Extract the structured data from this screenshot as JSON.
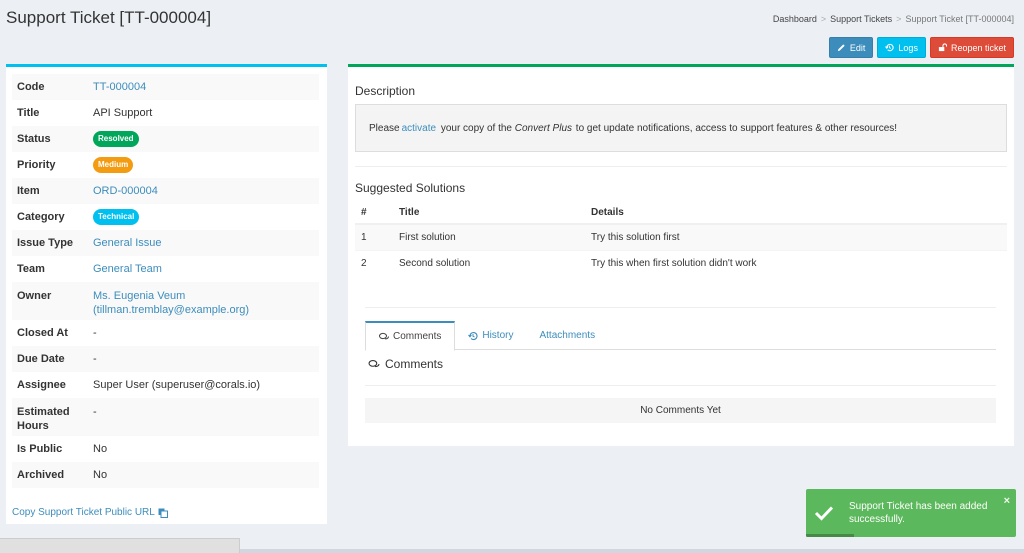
{
  "header": {
    "title": "Support Ticket [TT-000004]",
    "breadcrumb": [
      {
        "label": "Dashboard"
      },
      {
        "label": "Support Tickets"
      },
      {
        "label": "Support Ticket [TT-000004]"
      }
    ],
    "buttons": {
      "edit": "Edit",
      "logs": "Logs",
      "reopen": "Reopen ticket"
    }
  },
  "details": {
    "code": {
      "label": "Code",
      "value": "TT-000004"
    },
    "title": {
      "label": "Title",
      "value": "API Support"
    },
    "status": {
      "label": "Status",
      "value": "Resolved",
      "color": "#00a65a"
    },
    "priority": {
      "label": "Priority",
      "value": "Medium",
      "color": "#f39c12"
    },
    "item": {
      "label": "Item",
      "value": "ORD-000004"
    },
    "category": {
      "label": "Category",
      "value": "Technical",
      "color": "#00c0ef"
    },
    "issue_type": {
      "label": "Issue Type",
      "value": "General Issue"
    },
    "team": {
      "label": "Team",
      "value": "General Team"
    },
    "owner": {
      "label": "Owner",
      "name": "Ms. Eugenia Veum",
      "email": "(tillman.tremblay@example.org)"
    },
    "closed_at": {
      "label": "Closed At",
      "value": "-"
    },
    "due_date": {
      "label": "Due Date",
      "value": "-"
    },
    "assignee": {
      "label": "Assignee",
      "value": "Super User (superuser@corals.io)"
    },
    "estimated_hours": {
      "label": "Estimated Hours",
      "value": "-"
    },
    "is_public": {
      "label": "Is Public",
      "value": "No"
    },
    "archived": {
      "label": "Archived",
      "value": "No"
    }
  },
  "copy_link": "Copy Support Ticket Public URL",
  "description": {
    "title": "Description",
    "pre": "Please ",
    "link": "activate",
    "mid": " your copy of the ",
    "product": "Convert Plus",
    "post": " to get update notifications, access to support features & other resources!"
  },
  "solutions": {
    "title": "Suggested Solutions",
    "columns": {
      "num": "#",
      "title": "Title",
      "details": "Details"
    },
    "rows": [
      {
        "num": "1",
        "title": "First solution",
        "details": "Try this solution first"
      },
      {
        "num": "2",
        "title": "Second solution",
        "details": "Try this when first solution didn't work"
      }
    ]
  },
  "tabs": {
    "comments": "Comments",
    "history": "History",
    "attachments": "Attachments"
  },
  "comments": {
    "heading": "Comments",
    "empty": "No Comments Yet"
  },
  "toast": {
    "message": "Support Ticket has been added successfully.",
    "close": "×"
  }
}
